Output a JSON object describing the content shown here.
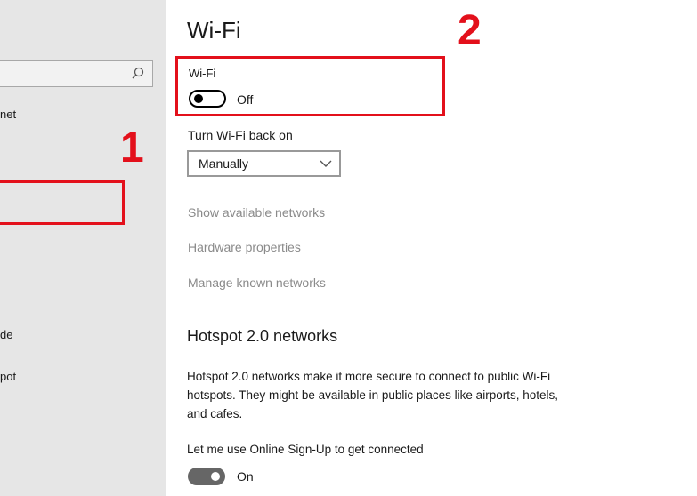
{
  "sidebar": {
    "items": [
      {
        "label": "net"
      },
      {
        "label": "de"
      },
      {
        "label": "pot"
      }
    ]
  },
  "annotations": {
    "step1": "1",
    "step2": "2"
  },
  "page": {
    "title": "Wi-Fi"
  },
  "wifi": {
    "label": "Wi-Fi",
    "state": "Off"
  },
  "turn_back_on": {
    "label": "Turn Wi-Fi back on",
    "selected": "Manually"
  },
  "links": [
    "Show available networks",
    "Hardware properties",
    "Manage known networks"
  ],
  "hotspot": {
    "heading": "Hotspot 2.0 networks",
    "description": "Hotspot 2.0 networks make it more secure to connect to public Wi-Fi hotspots. They might be available in public places like airports, hotels, and cafes.",
    "signup_label": "Let me use Online Sign-Up to get connected",
    "signup_state": "On"
  },
  "colors": {
    "annotation_red": "#e3101b",
    "sidebar_bg": "#e6e6e6",
    "link_gray": "#8a8a8a"
  }
}
